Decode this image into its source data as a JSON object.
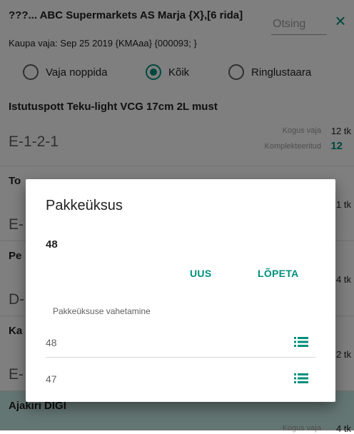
{
  "header": {
    "title": "???... ABC Supermarkets AS Marja {X},[6 rida]",
    "subtitle": "Kaupa vaja: Sep 25 2019 {KMAaa}   {000093; }",
    "search_placeholder": "Otsing",
    "close_icon": "×"
  },
  "filter": {
    "options": [
      {
        "label": "Vaja noppida",
        "selected": false
      },
      {
        "label": "Kõik",
        "selected": true
      },
      {
        "label": "Ringlustaara",
        "selected": false
      }
    ]
  },
  "list": {
    "items": [
      {
        "title": "Istutuspott Teku-light VCG 17cm 2L must",
        "location": "E-1-2-1",
        "qty_label": "Kogus vaja",
        "qty_value": "12 tk",
        "completed_label": "Komplekteeritud",
        "completed_value": "12"
      },
      {
        "title": "To",
        "location": "E-",
        "qty_value": "1 tk"
      },
      {
        "title": "Pe",
        "location": "D-",
        "qty_value": "4 tk"
      },
      {
        "title": "Ka",
        "location": "E-",
        "qty_value": "2 tk"
      },
      {
        "title": "Ajakiri DIGI",
        "qty_label": "Kogus vaja",
        "qty_value": "4 tk"
      }
    ]
  },
  "dialog": {
    "title": "Pakkeüksus",
    "current_value": "48",
    "new_button": "UUS",
    "finish_button": "LÕPETA",
    "section_label": "Pakkeüksuse vahetamine",
    "options": [
      "48",
      "47"
    ]
  },
  "colors": {
    "accent": "#008f7a",
    "highlight_row": "#c8ede6"
  }
}
